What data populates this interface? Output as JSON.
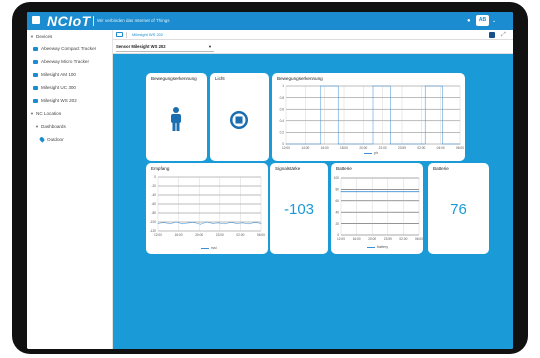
{
  "header": {
    "brand": "NCIoT",
    "tagline": "Wir verbinden das Internet of Things",
    "user_badge": "AB"
  },
  "sidebar": {
    "items": [
      {
        "label": "Devices",
        "kind": "group"
      },
      {
        "label": "Abeeway Compact Tracker",
        "kind": "device"
      },
      {
        "label": "Abeeway Micro Tracker",
        "kind": "device"
      },
      {
        "label": "Milesight AM 100",
        "kind": "device"
      },
      {
        "label": "Milesight UC 300",
        "kind": "device"
      },
      {
        "label": "Milesight WS 202",
        "kind": "device"
      },
      {
        "label": "NC Location",
        "kind": "group"
      },
      {
        "label": "Dashboards",
        "kind": "subgroup"
      },
      {
        "label": "Outdoor",
        "kind": "location"
      }
    ]
  },
  "toolbar": {
    "tab_label": "Milesight WS 202",
    "device_select_value": "Sensor Milesight WS 202"
  },
  "colors": {
    "accent": "#1b8ccf",
    "content_bg": "#1b9ad8",
    "series": "#3a8fd6"
  },
  "widgets": {
    "motion": {
      "title": "Bewegungserkennung",
      "icon": "person-icon"
    },
    "light": {
      "title": "Licht",
      "icon": "stop-circle-icon"
    },
    "motion_chart": {
      "title": "Bewegungserkennung",
      "legend": "pir"
    },
    "reception": {
      "title": "Empfang",
      "legend": "rssi"
    },
    "signal": {
      "title": "Signalstärke",
      "value": "-103"
    },
    "battery_chart": {
      "title": "Batterie",
      "legend": "battery"
    },
    "battery": {
      "title": "Batterie",
      "value": "76"
    }
  },
  "chart_data": [
    {
      "type": "line",
      "title": "Bewegungserkennung",
      "x": [
        "12:00",
        "14:00",
        "16:00",
        "18:00",
        "20:00",
        "22:00",
        "23:59",
        "02:00",
        "04:00",
        "06:00"
      ],
      "ylim": [
        0,
        1
      ],
      "yticks": [
        "0",
        "0.2",
        "0.4",
        "0.6",
        "0.8",
        "1"
      ],
      "series": [
        {
          "name": "pir",
          "values": [
            0,
            0,
            1,
            0,
            0,
            1,
            0,
            0,
            1,
            0,
            0
          ]
        }
      ],
      "grid": true,
      "legend": "bottom"
    },
    {
      "type": "line",
      "title": "Empfang",
      "x": [
        "12:00",
        "16:00",
        "20:00",
        "23:00",
        "02:00",
        "06:00"
      ],
      "ylim": [
        -120,
        0
      ],
      "yticks": [
        "0",
        "-20",
        "-40",
        "-60",
        "-80",
        "-100",
        "-120"
      ],
      "series": [
        {
          "name": "rssi",
          "values": [
            -103,
            -101,
            -104,
            -100,
            -104,
            -102,
            -101,
            -105,
            -100,
            -103,
            -102,
            -104,
            -101,
            -103,
            -102,
            -104,
            -101,
            -103
          ]
        }
      ],
      "grid": true,
      "legend": "bottom"
    },
    {
      "type": "line",
      "title": "Batterie",
      "x": [
        "12:00",
        "16:00",
        "20:00",
        "23:59",
        "02:00",
        "06:00"
      ],
      "ylim": [
        0,
        100
      ],
      "yticks": [
        "0",
        "20",
        "40",
        "60",
        "80",
        "100"
      ],
      "series": [
        {
          "name": "battery",
          "values": [
            76,
            76,
            76,
            76,
            76,
            76
          ]
        }
      ],
      "grid": true,
      "legend": "bottom"
    }
  ]
}
